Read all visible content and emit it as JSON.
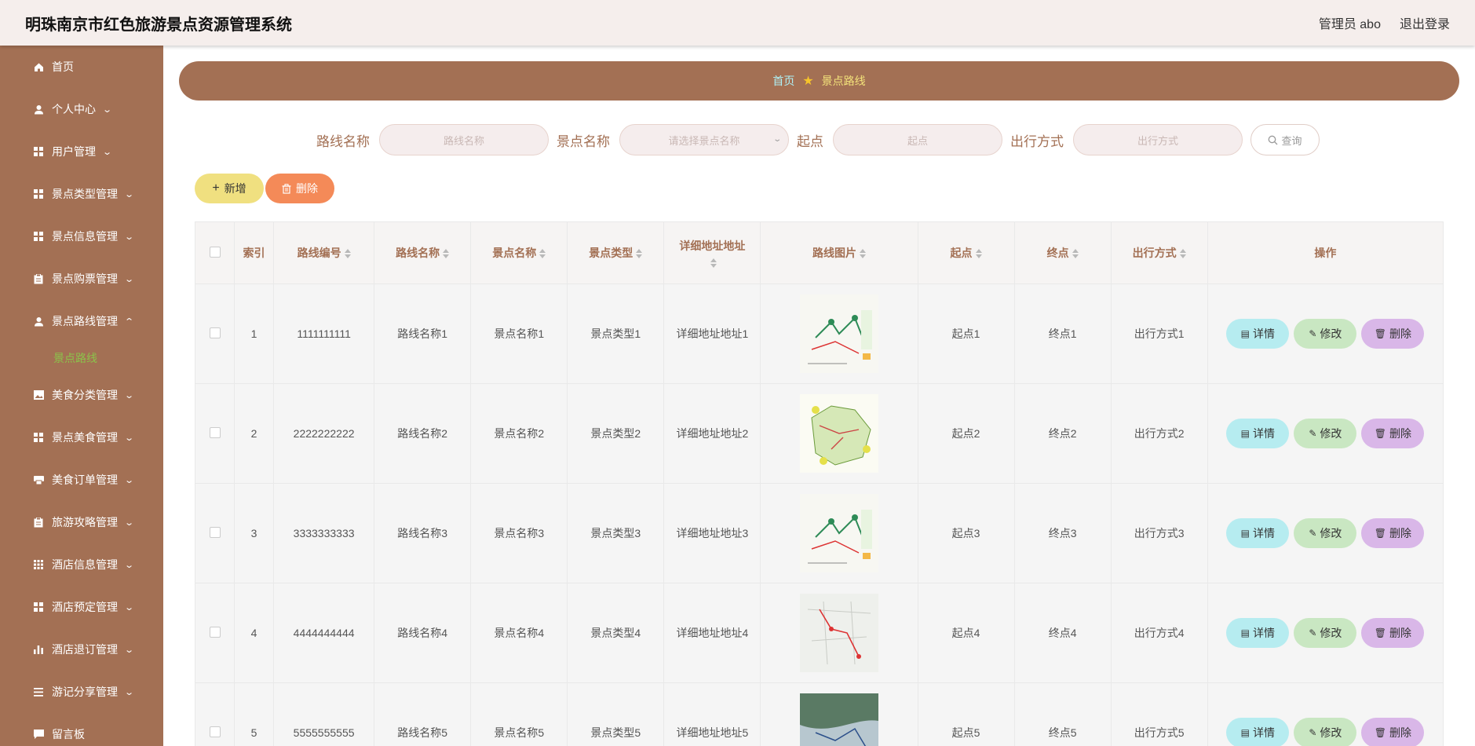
{
  "header": {
    "title": "明珠南京市红色旅游景点资源管理系统",
    "user": "管理员 abo",
    "logout": "退出登录"
  },
  "sidebar": {
    "items": [
      {
        "label": "首页",
        "icon": "home-icon",
        "arrow": false
      },
      {
        "label": "个人中心",
        "icon": "user-icon",
        "arrow": true
      },
      {
        "label": "用户管理",
        "icon": "grid-icon",
        "arrow": true
      },
      {
        "label": "景点类型管理",
        "icon": "grid-icon",
        "arrow": true
      },
      {
        "label": "景点信息管理",
        "icon": "grid-icon",
        "arrow": true
      },
      {
        "label": "景点购票管理",
        "icon": "clipboard-icon",
        "arrow": true
      },
      {
        "label": "景点路线管理",
        "icon": "user-icon",
        "arrow": true,
        "expanded": true
      },
      {
        "label": "美食分类管理",
        "icon": "image-icon",
        "arrow": true
      },
      {
        "label": "景点美食管理",
        "icon": "grid-icon",
        "arrow": true
      },
      {
        "label": "美食订单管理",
        "icon": "printer-icon",
        "arrow": true
      },
      {
        "label": "旅游攻略管理",
        "icon": "clipboard-icon",
        "arrow": true
      },
      {
        "label": "酒店信息管理",
        "icon": "apps-icon",
        "arrow": true
      },
      {
        "label": "酒店预定管理",
        "icon": "grid-icon",
        "arrow": true
      },
      {
        "label": "酒店退订管理",
        "icon": "bar-chart-icon",
        "arrow": true
      },
      {
        "label": "游记分享管理",
        "icon": "list-icon",
        "arrow": true
      },
      {
        "label": "留言板",
        "icon": "message-icon",
        "arrow": false
      }
    ],
    "sub_item": "景点路线"
  },
  "breadcrumb": {
    "home": "首页",
    "current": "景点路线"
  },
  "search": {
    "route_name_label": "路线名称",
    "route_name_placeholder": "路线名称",
    "spot_name_label": "景点名称",
    "spot_name_placeholder": "请选择景点名称",
    "start_label": "起点",
    "start_placeholder": "起点",
    "travel_label": "出行方式",
    "travel_placeholder": "出行方式",
    "query_button": "查询"
  },
  "actions": {
    "add": "新增",
    "delete": "删除"
  },
  "table": {
    "headers": [
      "索引",
      "路线编号",
      "路线名称",
      "景点名称",
      "景点类型",
      "详细地址地址",
      "路线图片",
      "起点",
      "终点",
      "出行方式",
      "操作"
    ],
    "rows": [
      {
        "index": "1",
        "code": "1111111111",
        "route": "路线名称1",
        "spot": "景点名称1",
        "type": "景点类型1",
        "address": "详细地址地址1",
        "start": "起点1",
        "end": "终点1",
        "travel": "出行方式1",
        "image": "route-map-a"
      },
      {
        "index": "2",
        "code": "2222222222",
        "route": "路线名称2",
        "spot": "景点名称2",
        "type": "景点类型2",
        "address": "详细地址地址2",
        "start": "起点2",
        "end": "终点2",
        "travel": "出行方式2",
        "image": "route-map-b"
      },
      {
        "index": "3",
        "code": "3333333333",
        "route": "路线名称3",
        "spot": "景点名称3",
        "type": "景点类型3",
        "address": "详细地址地址3",
        "start": "起点3",
        "end": "终点3",
        "travel": "出行方式3",
        "image": "route-map-a"
      },
      {
        "index": "4",
        "code": "4444444444",
        "route": "路线名称4",
        "spot": "景点名称4",
        "type": "景点类型4",
        "address": "详细地址地址4",
        "start": "起点4",
        "end": "终点4",
        "travel": "出行方式4",
        "image": "route-map-c"
      },
      {
        "index": "5",
        "code": "5555555555",
        "route": "路线名称5",
        "spot": "景点名称5",
        "type": "景点类型5",
        "address": "详细地址地址5",
        "start": "起点5",
        "end": "终点5",
        "travel": "出行方式5",
        "image": "route-map-d"
      }
    ],
    "row_buttons": {
      "detail": "详情",
      "edit": "修改",
      "delete": "删除"
    }
  },
  "colors": {
    "brand": "#a37054",
    "topbar": "#f5eeec",
    "active_sub": "#8bc34a",
    "detail": "#b6ecf0",
    "edit": "#c9e7c2",
    "delete": "#d9b7e8",
    "add": "#f0e080",
    "danger": "#f48a58"
  }
}
